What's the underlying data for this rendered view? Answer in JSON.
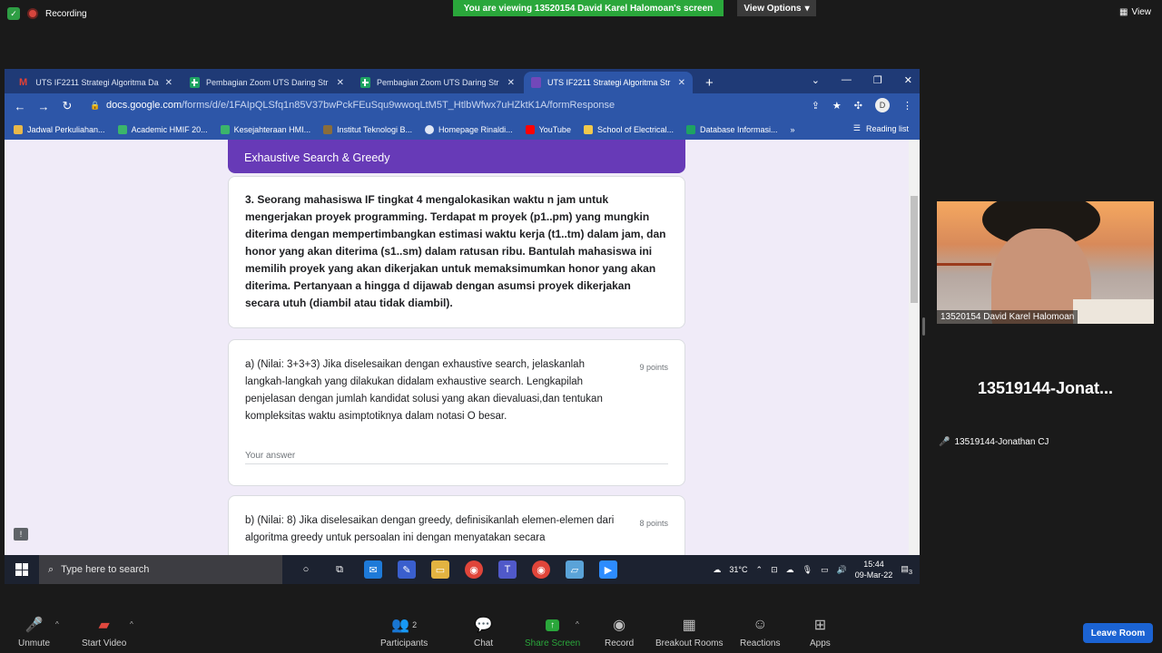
{
  "zoom_top": {
    "recording_label": "Recording",
    "viewing_banner": "You are viewing 13520154 David Karel Halomoan's screen",
    "view_options": "View Options",
    "view_button": "View"
  },
  "browser": {
    "tabs": [
      {
        "label": "UTS IF2211 Strategi Algoritma Da",
        "icon": "gmail-icon"
      },
      {
        "label": "Pembagian Zoom UTS Daring Str",
        "icon": "sheets-icon"
      },
      {
        "label": "Pembagian Zoom UTS Daring Str",
        "icon": "sheets-icon"
      },
      {
        "label": "UTS IF2211 Strategi Algoritma Str",
        "icon": "forms-icon",
        "active": true
      }
    ],
    "url_domain": "docs.google.com",
    "url_path": "/forms/d/e/1FAIpQLSfq1n85V37bwPckFEuSqu9wwoqLtM5T_HtlbWfwx7uHZktK1A/formResponse",
    "profile_initial": "D",
    "bookmarks": [
      "Jadwal Perkuliahan...",
      "Academic HMIF 20...",
      "Kesejahteraan HMI...",
      "Institut Teknologi B...",
      "Homepage Rinaldi...",
      "YouTube",
      "School of Electrical...",
      "Database Informasi..."
    ],
    "reading_list": "Reading list",
    "bookmark_more": "»"
  },
  "form": {
    "section_title": "Exhaustive Search & Greedy",
    "question3": "3. Seorang mahasiswa IF tingkat 4 mengalokasikan waktu n jam untuk mengerjakan proyek programming. Terdapat m proyek (p1..pm) yang mungkin diterima dengan mempertimbangkan estimasi waktu kerja (t1..tm) dalam jam, dan honor yang akan diterima (s1..sm) dalam ratusan ribu. Bantulah mahasiswa ini memilih proyek yang akan dikerjakan untuk memaksimumkan honor yang akan diterima. Pertanyaan a hingga d dijawab dengan asumsi proyek dikerjakan secara utuh (diambil atau tidak diambil).",
    "qa_text": "a) (Nilai: 3+3+3) Jika diselesaikan dengan exhaustive search, jelaskanlah langkah-langkah yang dilakukan didalam exhaustive search. Lengkapilah penjelasan dengan jumlah kandidat solusi yang akan dievaluasi,dan tentukan kompleksitas waktu asimptotiknya dalam notasi O besar.",
    "qa_points": "9 points",
    "qa_answer_placeholder": "Your answer",
    "qb_text": "b) (Nilai: 8) Jika diselesaikan dengan greedy, definisikanlah elemen-elemen dari algoritma greedy untuk persoalan ini dengan menyatakan secara",
    "qb_points": "8 points"
  },
  "taskbar": {
    "search_placeholder": "Type here to search",
    "temperature": "31°C",
    "time": "15:44",
    "date": "09-Mar-22",
    "notification_count": "3"
  },
  "participants_video": {
    "p1_name": "13520154 David Karel Halomoan",
    "p2_big_name": "13519144-Jonat...",
    "p2_small_name": "13519144-Jonathan CJ"
  },
  "zoom_toolbar": {
    "unmute": "Unmute",
    "start_video": "Start Video",
    "participants_count": "2",
    "participants": "Participants",
    "chat": "Chat",
    "share_screen": "Share Screen",
    "record": "Record",
    "breakout_rooms": "Breakout Rooms",
    "reactions": "Reactions",
    "apps": "Apps",
    "leave_room": "Leave Room"
  },
  "colors": {
    "share_green": "#2aa73b",
    "leave_blue": "#1b63d3",
    "forms_purple": "#673ab7",
    "chrome_blue": "#2d56a8"
  }
}
